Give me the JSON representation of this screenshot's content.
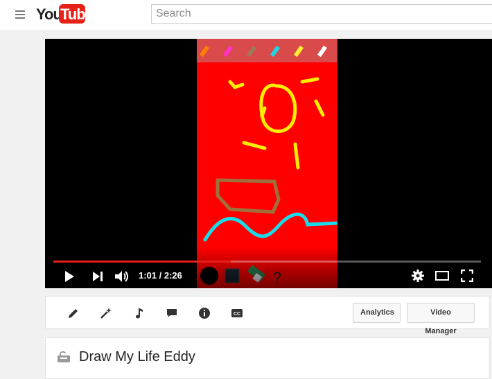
{
  "header": {
    "logo_you": "You",
    "logo_tube": "Tube",
    "search_placeholder": "Search"
  },
  "player": {
    "time_display": "1:01 / 2:26",
    "progress_fraction": 0.415,
    "help_glyph": "?",
    "marker_colors": [
      "#ff7f00",
      "#ff33cc",
      "#a07a55",
      "#22d3e6",
      "#ffee33",
      "#ffffff"
    ],
    "canvas_color": "#ff0000"
  },
  "action_bar": {
    "analytics_label": "Analytics",
    "video_manager_label": "Video Manager",
    "cc_label": "CC"
  },
  "video": {
    "title": "Draw My Life Eddy"
  }
}
